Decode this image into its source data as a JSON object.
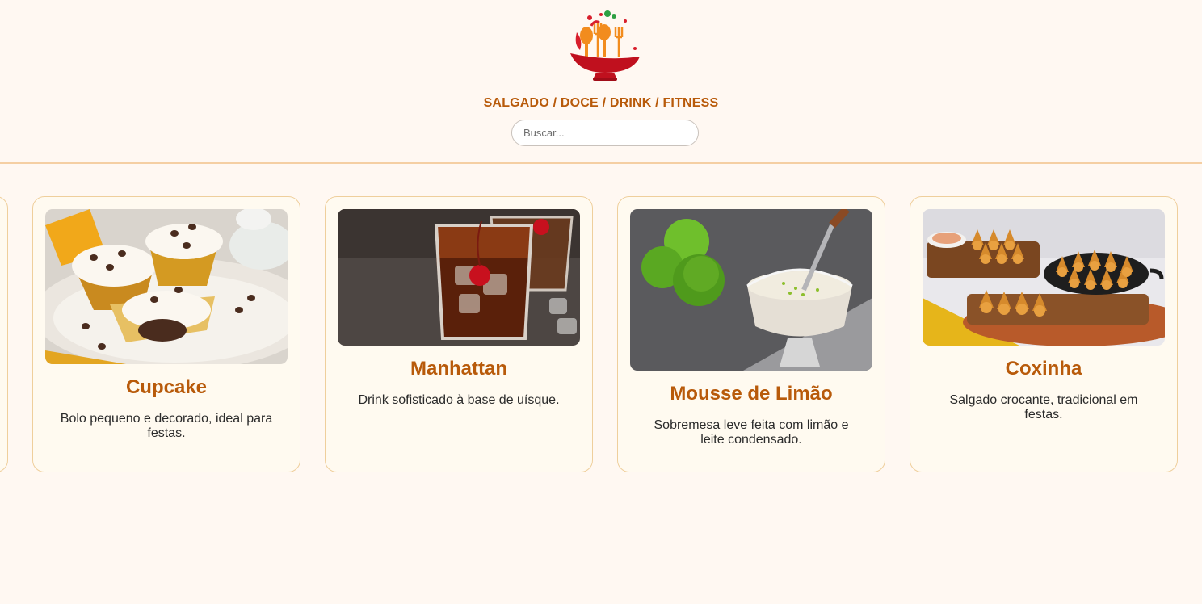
{
  "header": {
    "categories": "SALGADO / DOCE / DRINK / FITNESS",
    "search_placeholder": "Buscar..."
  },
  "cards": [
    {
      "title": "Cupcake",
      "description": "Bolo pequeno e decorado, ideal para festas."
    },
    {
      "title": "Manhattan",
      "description": "Drink sofisticado à base de uísque."
    },
    {
      "title": "Mousse de Limão",
      "description": "Sobremesa leve feita com limão e leite condensado."
    },
    {
      "title": "Coxinha",
      "description": "Salgado crocante, tradicional em festas."
    }
  ],
  "colors": {
    "background": "#fff8f2",
    "accent": "#b85a0a",
    "card_border": "#efcf9c",
    "card_background": "#fffaf0"
  }
}
